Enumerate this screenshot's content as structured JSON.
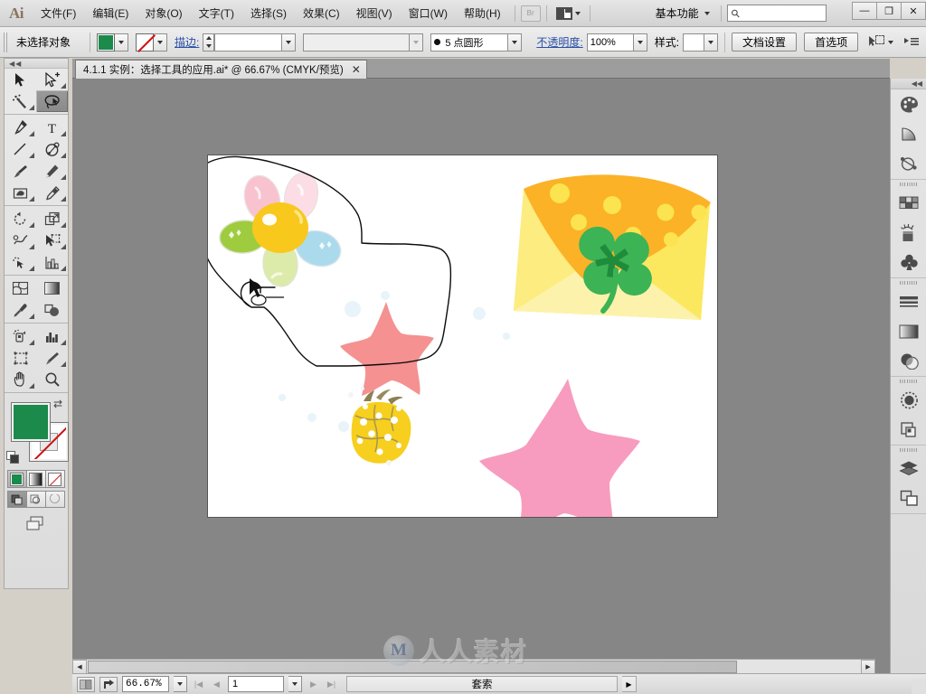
{
  "app": {
    "logo": "Ai",
    "title": "Adobe Illustrator"
  },
  "menubar": {
    "items": [
      {
        "label": "文件(F)",
        "name": "menu-file"
      },
      {
        "label": "编辑(E)",
        "name": "menu-edit"
      },
      {
        "label": "对象(O)",
        "name": "menu-object"
      },
      {
        "label": "文字(T)",
        "name": "menu-type"
      },
      {
        "label": "选择(S)",
        "name": "menu-select"
      },
      {
        "label": "效果(C)",
        "name": "menu-effect"
      },
      {
        "label": "视图(V)",
        "name": "menu-view"
      },
      {
        "label": "窗口(W)",
        "name": "menu-window"
      },
      {
        "label": "帮助(H)",
        "name": "menu-help"
      }
    ],
    "bridge_label": "Br",
    "workspace": "基本功能",
    "search_placeholder": "",
    "search_value": "",
    "window_buttons": {
      "minimize": "—",
      "maximize": "❐",
      "close": "✕"
    }
  },
  "controlbar": {
    "selection_label": "未选择对象",
    "fill_color": "#1b8a4b",
    "stroke_color": "none",
    "stroke_label": "描边:",
    "stroke_weight": "",
    "stroke_profile": "",
    "brush_definition": "5 点圆形",
    "opacity_label": "不透明度:",
    "opacity_value": "100%",
    "style_label": "样式:",
    "document_setup": "文档设置",
    "preferences": "首选项"
  },
  "tab": {
    "title": "4.1.1 实例：选择工具的应用.ai* @ 66.67% (CMYK/预览)",
    "close": "✕"
  },
  "toolbox": {
    "tools": [
      {
        "name": "selection-tool",
        "icon": "arrow",
        "selected": false,
        "more": false
      },
      {
        "name": "direct-selection-tool",
        "icon": "arrow-plus",
        "selected": false,
        "more": true
      },
      {
        "name": "magic-wand-tool",
        "icon": "magic-wand",
        "selected": false,
        "more": false
      },
      {
        "name": "lasso-tool",
        "icon": "lasso",
        "selected": true,
        "more": false
      },
      {
        "name": "pen-tool",
        "icon": "pen",
        "selected": false,
        "more": true
      },
      {
        "name": "type-tool",
        "icon": "type-T",
        "selected": false,
        "more": true
      },
      {
        "name": "line-segment-tool",
        "icon": "line",
        "selected": false,
        "more": true
      },
      {
        "name": "ellipse-shape-tool",
        "icon": "shape-circle",
        "selected": false,
        "more": true
      },
      {
        "name": "paintbrush-tool",
        "icon": "paintbrush",
        "selected": false,
        "more": false
      },
      {
        "name": "pencil-tool",
        "icon": "pencil",
        "selected": false,
        "more": true
      },
      {
        "name": "blob-brush-tool",
        "icon": "blob-brush",
        "selected": false,
        "more": true
      },
      {
        "name": "eraser-tool",
        "icon": "eraser",
        "selected": false,
        "more": true
      },
      {
        "name": "rotate-tool",
        "icon": "rotate",
        "selected": false,
        "more": true
      },
      {
        "name": "scale-tool",
        "icon": "scale",
        "selected": false,
        "more": true
      },
      {
        "name": "width-warp-tool",
        "icon": "warp",
        "selected": false,
        "more": true
      },
      {
        "name": "free-transform-tool",
        "icon": "free-transform",
        "selected": false,
        "more": false
      },
      {
        "name": "shape-builder-tool",
        "icon": "shape-builder",
        "selected": false,
        "more": true
      },
      {
        "name": "graph-tool",
        "icon": "graph-bars",
        "selected": false,
        "more": true
      },
      {
        "name": "mesh-tool",
        "icon": "mesh",
        "selected": false,
        "more": false
      },
      {
        "name": "gradient-tool",
        "icon": "gradient",
        "selected": false,
        "more": false
      },
      {
        "name": "eyedropper-tool",
        "icon": "eyedropper",
        "selected": false,
        "more": true
      },
      {
        "name": "blend-tool",
        "icon": "blend",
        "selected": false,
        "more": false
      },
      {
        "name": "symbol-sprayer-tool",
        "icon": "symbol-sprayer",
        "selected": false,
        "more": true
      },
      {
        "name": "column-graph-tool",
        "icon": "column-graph",
        "selected": false,
        "more": true
      },
      {
        "name": "artboard-tool",
        "icon": "artboard",
        "selected": false,
        "more": false
      },
      {
        "name": "slice-tool",
        "icon": "slice-knife",
        "selected": false,
        "more": true
      },
      {
        "name": "hand-tool",
        "icon": "hand",
        "selected": false,
        "more": true
      },
      {
        "name": "zoom-tool",
        "icon": "magnifier",
        "selected": false,
        "more": false
      }
    ],
    "fill_color": "#1b8a4b",
    "stroke_color": "#ffffff",
    "modes": [
      {
        "name": "color-mode-button",
        "icon": "solid-color",
        "active": true
      },
      {
        "name": "gradient-mode-button",
        "icon": "gradient",
        "active": false
      },
      {
        "name": "none-mode-button",
        "icon": "none",
        "active": false
      }
    ],
    "draw_modes": [
      {
        "name": "draw-normal-button",
        "active": true
      },
      {
        "name": "draw-behind-button",
        "active": false
      },
      {
        "name": "draw-inside-button",
        "active": false
      }
    ]
  },
  "dock": {
    "icons": [
      {
        "name": "color-panel-icon",
        "glyph": "palette"
      },
      {
        "name": "color-guide-panel-icon",
        "glyph": "quarter-circle"
      },
      {
        "name": "appearance-panel-icon",
        "glyph": "appearance"
      },
      {
        "name": "swatches-panel-icon",
        "glyph": "swatch-grid"
      },
      {
        "name": "brushes-panel-icon",
        "glyph": "brush-pot"
      },
      {
        "name": "symbols-panel-icon",
        "glyph": "clover"
      },
      {
        "name": "stroke-panel-icon",
        "glyph": "stroke-lines"
      },
      {
        "name": "gradient-panel-icon",
        "glyph": "gradient-box"
      },
      {
        "name": "transparency-panel-icon",
        "glyph": "transparency-circles"
      },
      {
        "name": "graphic-styles-panel-icon",
        "glyph": "styles-circle"
      },
      {
        "name": "transform-panel-icon",
        "glyph": "transform-squares"
      },
      {
        "name": "layers-panel-icon",
        "glyph": "layers-stack"
      },
      {
        "name": "align-panel-icon",
        "glyph": "align-squares"
      }
    ]
  },
  "statusbar": {
    "zoom": "66.67%",
    "page": "1",
    "status_text": "套索",
    "prev_page": "◀",
    "next_page": "▶",
    "first_page": "|◀",
    "last_page": "▶|"
  },
  "watermark": {
    "logo": "M",
    "text": "人人素材"
  },
  "artwork": {
    "description": "Illustration artboard with flower, polka-dot envelope with clover, two pink stars and a yellow pineapple; a freehand lasso selection path is drawn across the upper-left region.",
    "objects": [
      {
        "name": "flower-graphic",
        "colors": [
          "#f7c0cc",
          "#fbd9e4",
          "#9ccc3c",
          "#f9c81d",
          "#a9d9ea",
          "#d9e8a8"
        ]
      },
      {
        "name": "envelope-graphic",
        "colors": [
          "#fbb227",
          "#fde04a",
          "#fdf2a8",
          "#37a84e",
          "#1f8c3c"
        ]
      },
      {
        "name": "small-star-graphic",
        "colors": [
          "#f59191"
        ]
      },
      {
        "name": "large-star-graphic",
        "colors": [
          "#f79cbe"
        ]
      },
      {
        "name": "pineapple-graphic",
        "colors": [
          "#f7cf1e",
          "#9a8c58",
          "#ffffff"
        ]
      },
      {
        "name": "lasso-selection-path",
        "colors": [
          "#000000"
        ]
      }
    ]
  }
}
